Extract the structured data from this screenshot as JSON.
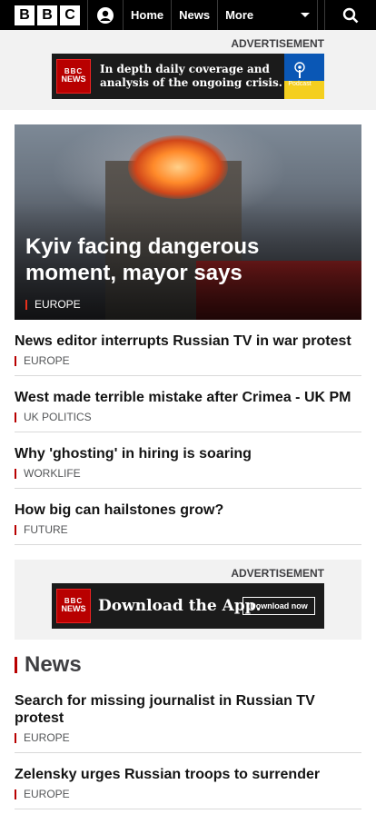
{
  "nav": {
    "logo": [
      "B",
      "B",
      "C"
    ],
    "links": [
      "Home",
      "News"
    ],
    "more": "More"
  },
  "ad_label": "ADVERTISEMENT",
  "ad1": {
    "badge": [
      "BBC",
      "NEWS"
    ],
    "text_line1": "In depth daily coverage and",
    "text_line2": "analysis of the ongoing crisis.",
    "podcast": "Podcast"
  },
  "hero": {
    "title": "Kyiv facing dangerous moment, mayor says",
    "section": "EUROPE"
  },
  "stories": [
    {
      "title": "News editor interrupts Russian TV in war protest",
      "section": "EUROPE"
    },
    {
      "title": "West made terrible mistake after Crimea - UK PM",
      "section": "UK POLITICS"
    },
    {
      "title": "Why 'ghosting' in hiring is soaring",
      "section": "WORKLIFE"
    },
    {
      "title": "How big can hailstones grow?",
      "section": "FUTURE"
    }
  ],
  "ad2": {
    "badge": [
      "BBC",
      "NEWS"
    ],
    "text": "Download the App.",
    "button": "Download now"
  },
  "news_section": {
    "title": "News",
    "stories": [
      {
        "title": "Search for missing journalist in Russian TV protest",
        "section": "EUROPE"
      },
      {
        "title": "Zelensky urges Russian troops to surrender",
        "section": "EUROPE"
      }
    ]
  },
  "colors": {
    "accent": "#b80000",
    "nav_bg": "#000000",
    "ad_bg": "#f2f2f2"
  }
}
